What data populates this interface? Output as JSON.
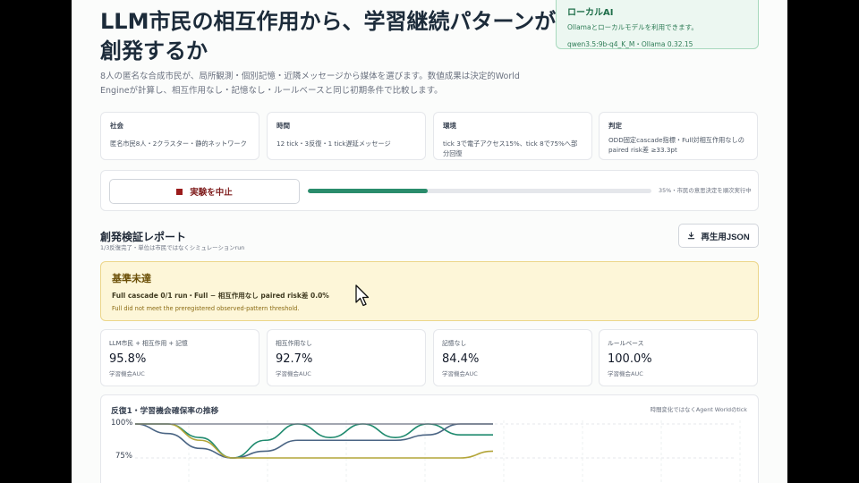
{
  "title": "LLM市民の相互作用から、学習継続パターンが創発するか",
  "intro": "8人の匿名な合成市民が、局所観測・個別記憶・近隣メッセージから媒体を選びます。数値成果は決定的World Engineが計算し、相互作用なし・記憶なし・ルールベースと同じ初期条件で比較します。",
  "ai": {
    "title": "ローカルAI",
    "desc": "Ollamaとローカルモデルを利用できます。",
    "model": "qwen3.5:9b-q4_K_M・Ollama 0.32.15"
  },
  "info": [
    {
      "label": "社会",
      "value": "匿名市民8人・2クラスター・静的ネットワーク"
    },
    {
      "label": "時間",
      "value": "12 tick・3反復・1 tick遅延メッセージ"
    },
    {
      "label": "環境",
      "value": "tick 3で電子アクセス15%、tick 8で75%へ部分回復"
    },
    {
      "label": "判定",
      "value": "ODD固定cascade指標・Full対相互作用なしのpaired risk差 ≥33.3pt"
    }
  ],
  "run": {
    "stop_label": "実験を中止",
    "progress": 35,
    "progress_text": "35%・市民の意思決定を順次実行中"
  },
  "report": {
    "title": "創発検証レポート",
    "subtitle": "1/3反復完了・単位は市民ではなくシミュレーションrun",
    "regen_label": "再生用JSON"
  },
  "warning": {
    "title": "基準未達",
    "line": "Full cascade 0/1 run・Full − 相互作用なし paired risk差 0.0%",
    "en": "Full did not meet the preregistered observed-pattern threshold."
  },
  "stats": [
    {
      "label": "LLM市民 + 相互作用 + 記憶",
      "value": "95.8%",
      "unit": "学習機会AUC"
    },
    {
      "label": "相互作用なし",
      "value": "92.7%",
      "unit": "学習機会AUC"
    },
    {
      "label": "記憶なし",
      "value": "84.4%",
      "unit": "学習機会AUC"
    },
    {
      "label": "ルールベース",
      "value": "100.0%",
      "unit": "学習機会AUC"
    }
  ],
  "chart": {
    "title": "反復1・学習機会確保率の推移",
    "note": "時間変化ではなくAgent Worldのtick",
    "y_ticks": [
      "100%",
      "75%"
    ]
  },
  "chart_data": {
    "type": "line",
    "title": "反復1・学習機会確保率の推移",
    "x": [
      0,
      1,
      2,
      3,
      4,
      5,
      6,
      7,
      8,
      9,
      10,
      11
    ],
    "ylim": [
      70,
      100
    ],
    "y_ticks": [
      100,
      75
    ],
    "series": [
      {
        "color": "#1f8a6e",
        "values": [
          100,
          100,
          90,
          75,
          88,
          100,
          90,
          100,
          90,
          100,
          92,
          92
        ]
      },
      {
        "color": "#4b6584",
        "values": [
          100,
          93,
          82,
          75,
          80,
          88,
          88,
          88,
          88,
          92,
          100,
          100
        ]
      },
      {
        "color": "#b3a539",
        "values": [
          100,
          100,
          88,
          75,
          75,
          75,
          75,
          75,
          75,
          75,
          75,
          80
        ]
      },
      {
        "color": "#6b7280",
        "values": [
          100,
          100,
          100,
          100,
          100,
          100,
          100,
          100,
          100,
          100,
          100,
          100
        ]
      }
    ]
  },
  "colors": {
    "accent": "#2a8c6c",
    "warn_bg": "#fdf6d8",
    "ai_bg": "#ecf7f1"
  }
}
